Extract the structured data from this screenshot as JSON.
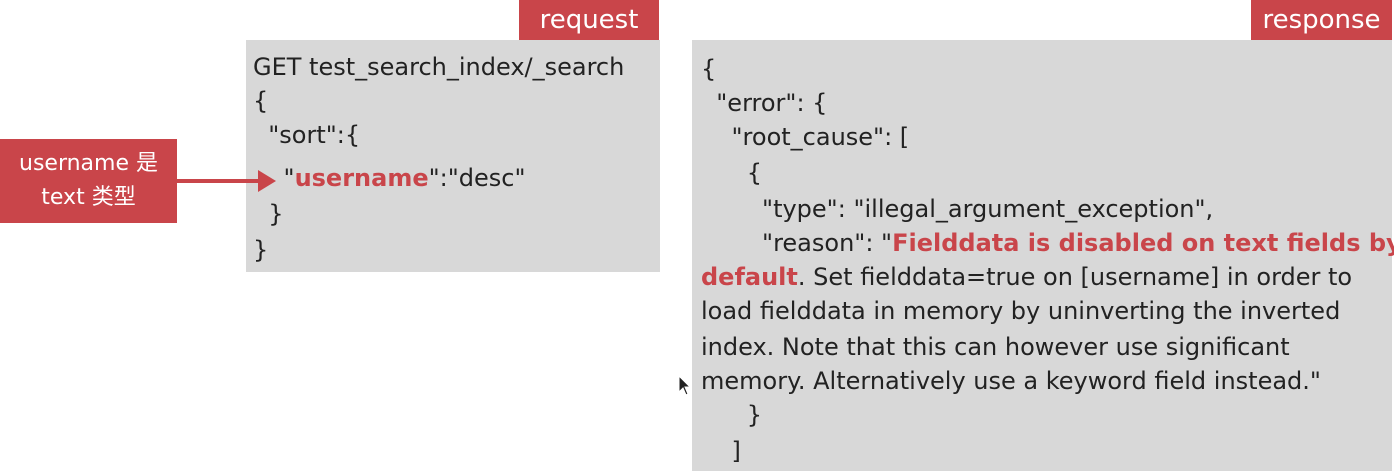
{
  "request": {
    "tag": "request",
    "lines": {
      "l0": "GET test_search_index/_search",
      "l1": "{",
      "l2": "  \"sort\":{",
      "l3_pre": "    \"",
      "l3_field": "username",
      "l3_post": "\":\"desc\"",
      "l4": "  }",
      "l5": "}"
    }
  },
  "response": {
    "tag": "response",
    "lines": {
      "l0": "{",
      "l1": "  \"error\": {",
      "l2": "    \"root_cause\": [",
      "l3": "      {",
      "l4": "        \"type\": \"illegal_argument_exception\",",
      "l5_pre": "        \"reason\": \"",
      "l5_hl": "Fielddata is disabled on text fields by",
      "l6_hl": "default",
      "l6_post": ". Set fielddata=true on [username] in order to",
      "l7": "load fielddata in memory by uninverting the inverted",
      "l8": "index. Note that this can however use significant",
      "l9": "memory. Alternatively use a keyword field instead.\"",
      "l10": "      }",
      "l11": "    ]"
    }
  },
  "annotation": {
    "line1": "username 是",
    "line2": "text 类型"
  },
  "colors": {
    "accent": "#c9454a",
    "panel": "#d8d8d8"
  }
}
